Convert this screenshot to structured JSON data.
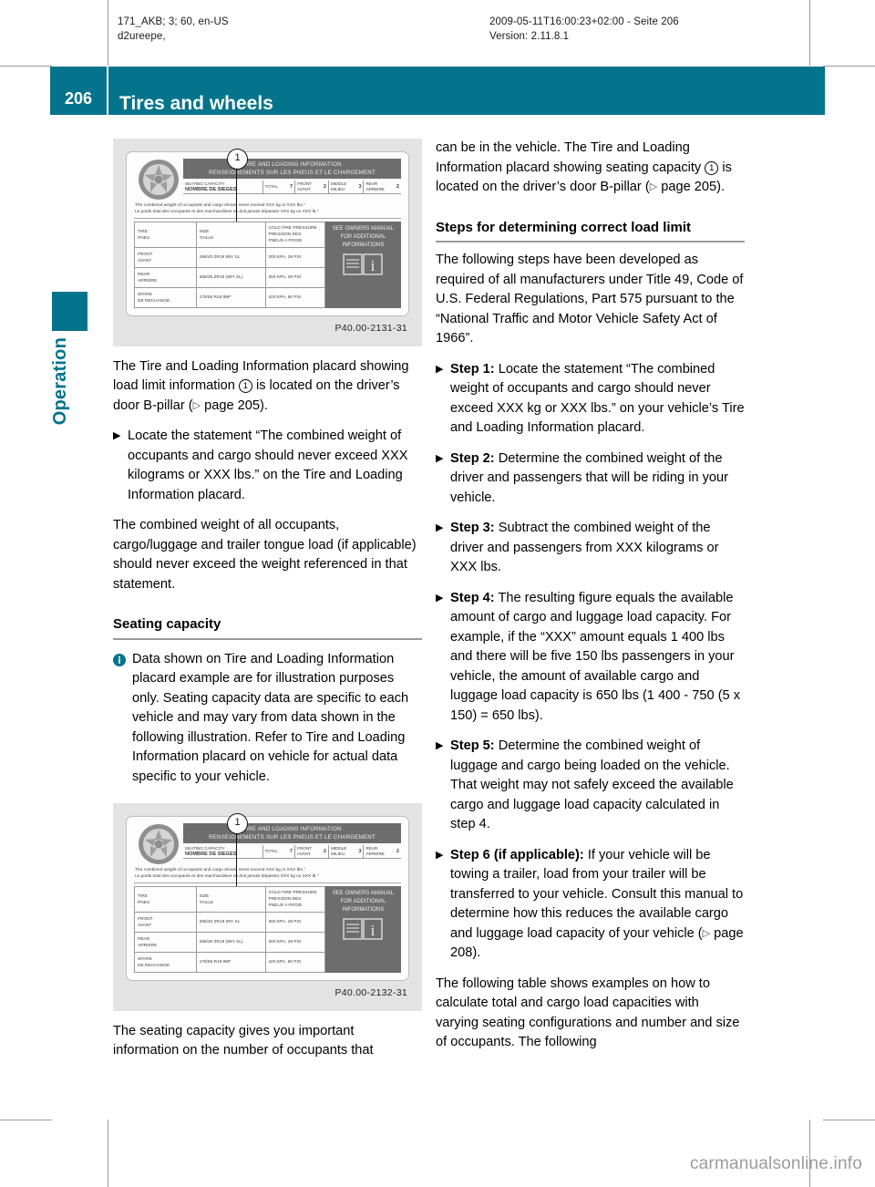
{
  "meta": {
    "left": "171_AKB; 3; 60, en-US\nd2ureepe,",
    "right": "2009-05-11T16:00:23+02:00 - Seite 206\nVersion: 2.11.8.1"
  },
  "chapter": {
    "page_number": "206",
    "title": "Tires and wheels",
    "section_tab": "Operation",
    "accent_color": "#04748c"
  },
  "figures": {
    "figure1": {
      "caption": "P40.00-2131-31",
      "callout": "1",
      "banner_line1": "TIRE AND LOADING INFORMATION",
      "banner_line2": "RENSEIGNEMENTS SUR LES PNEUS ET LE CHARGEMENT",
      "seating_label_en": "SEATING CAPACITY",
      "seating_label_fr": "NOMBRE DE SIEGES",
      "seat_cells": [
        {
          "label": "TOTAL",
          "value": "7"
        },
        {
          "label": "FRONT\nAVANT",
          "value": "2"
        },
        {
          "label": "MIDDLE\nMILIEU",
          "value": "3"
        },
        {
          "label": "REAR\nARRIERE",
          "value": "2"
        }
      ],
      "statement_en": "The combined weight of occupants and cargo should never exceed XXX kg or XXX lbs.\"",
      "statement_fr": "Le poids total des occupants et des marchandises ne doit jamais dépasser XXX kg ou XXX lb.\"",
      "table_headers": [
        "TIRE\nPNEU",
        "SIZE\nTAILLE",
        "COLD TIRE PRESSURE\nPRESSION DES\nPNEUS A FROID"
      ],
      "table_rows": [
        {
          "label": "FRONT\nAVANT",
          "size": "295/40 ZR19 99Y XL",
          "pressure": "300 KPA, 29 PSI"
        },
        {
          "label": "REAR\nARRIERE",
          "size": "285/35 ZR19 (99Y XL)",
          "pressure": "300 KPA, 29 PSI"
        },
        {
          "label": "SPARE\nDE RECHANGE",
          "size": "175/55 R19 95P",
          "pressure": "420 KPA, 60 PSI"
        }
      ],
      "owners_note": "SEE OWNERS MANUAL FOR ADDITIONAL INFORMATIONS"
    },
    "figure2": {
      "caption": "P40.00-2132-31",
      "callout": "1",
      "banner_line1": "TIRE AND LOADING INFORMATION",
      "banner_line2": "RENSEIGNEMENTS SUR LES PNEUS ET LE CHARGEMENT",
      "seating_label_en": "SEATING CAPACITY",
      "seating_label_fr": "NOMBRE DE SIEGES",
      "seat_cells": [
        {
          "label": "TOTAL",
          "value": "7"
        },
        {
          "label": "FRONT\nAVANT",
          "value": "2"
        },
        {
          "label": "MIDDLE\nMILIEU",
          "value": "3"
        },
        {
          "label": "REAR\nARRIERE",
          "value": "2"
        }
      ],
      "statement_en": "The combined weight of occupants and cargo should never exceed XXX kg or XXX lbs.\"",
      "statement_fr": "Le poids total des occupants et des marchandises ne doit jamais dépasser XXX kg ou XXX lb.\"",
      "table_headers": [
        "TIRE\nPNEU",
        "SIZE\nTAILLE",
        "COLD TIRE PRESSURE\nPRESSION DES\nPNEUS A FROID"
      ],
      "table_rows": [
        {
          "label": "FRONT\nAVANT",
          "size": "295/40 ZR19 99Y XL",
          "pressure": "300 KPA, 29 PSI"
        },
        {
          "label": "REAR\nARRIERE",
          "size": "285/35 ZR19 (99Y XL)",
          "pressure": "300 KPA, 29 PSI"
        },
        {
          "label": "SPARE\nDE RECHANGE",
          "size": "175/55 R19 95P",
          "pressure": "420 KPA, 60 PSI"
        }
      ],
      "owners_note": "SEE OWNERS MANUAL FOR ADDITIONAL INFORMATIONS"
    }
  },
  "left_column": {
    "para_1_part1": "The Tire and Loading Information placard showing load limit information ",
    "para_1_callout": "1",
    "para_1_part2": " is located on the driver’s door B-pillar (",
    "para_1_ref": " page 205).",
    "step_1": "Locate the statement “The combined weight of occupants and cargo should never exceed XXX kilograms or XXX lbs.” on the Tire and Loading Information placard.",
    "para_2": "The combined weight of all occupants, cargo/luggage and trailer tongue load (if applicable) should never exceed the weight referenced in that statement.",
    "subhead": "Seating capacity",
    "note": "Data shown on Tire and Loading Information placard example are for illustration purposes only. Seating capacity data are specific to each vehicle and may vary from data shown in the following illustration. Refer to Tire and Loading Information placard on vehicle for actual data specific to your vehicle.",
    "para_3": "The seating capacity gives you important information on the number of occupants that"
  },
  "right_column": {
    "para_1_part1": "can be in the vehicle. The Tire and Loading Information placard showing seating capacity ",
    "para_1_callout": "1",
    "para_1_part2": " is located on the driver’s door B-pillar (",
    "para_1_ref": " page 205).",
    "subhead": "Steps for determining correct load limit",
    "para_2": "The following steps have been developed as required of all manufacturers under Title 49, Code of U.S. Federal Regulations, Part 575 pursuant to the “National Traffic and Motor Vehicle Safety Act of 1966”.",
    "steps": [
      {
        "label": "Step 1:",
        "text": " Locate the statement “The combined weight of occupants and cargo should never exceed XXX kg or XXX lbs.” on your vehicle’s Tire and Loading Information placard."
      },
      {
        "label": "Step 2:",
        "text": " Determine the combined weight of the driver and passengers that will be riding in your vehicle."
      },
      {
        "label": "Step 3:",
        "text": " Subtract the combined weight of the driver and passengers from XXX kilograms or XXX lbs."
      },
      {
        "label": "Step 4:",
        "text": " The resulting figure equals the available amount of cargo and luggage load capacity. For example, if the “XXX” amount equals 1 400 lbs and there will be five 150 lbs passengers in your vehicle, the amount of available cargo and luggage load capacity is 650 lbs (1 400 - 750 (5 x 150) = 650 lbs)."
      },
      {
        "label": "Step 5:",
        "text": " Determine the combined weight of luggage and cargo being loaded on the vehicle. That weight may not safely exceed the available cargo and luggage load capacity calculated in step 4."
      },
      {
        "label": "Step 6 (if applicable):",
        "text": " If your vehicle will be towing a trailer, load from your trailer will be transferred to your vehicle. Consult this manual to determine how this reduces the available cargo and luggage load capacity of your vehicle ("
      }
    ],
    "step6_ref": " page 208).",
    "para_3": "The following table shows examples on how to calculate total and cargo load capacities with varying seating configurations and number and size of occupants. The following"
  },
  "watermark": "carmanualsonline.info"
}
